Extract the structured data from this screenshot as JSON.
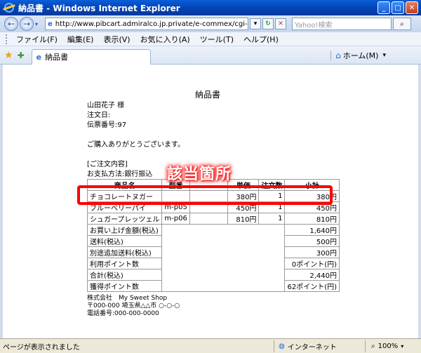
{
  "window": {
    "title": "納品書 - Windows Internet Explorer",
    "minimize": "_",
    "maximize": "□",
    "close": "✕"
  },
  "address": {
    "back": "←",
    "forward": "→",
    "dropdown": "▾",
    "url": "http://www.pibcart.admiralco.jp.private/e-commex/cgi-bin/admin/ex_sa",
    "refresh": "↻",
    "stop": "✕",
    "search_placeholder": "Yahoo!検索",
    "search_go": "⌕"
  },
  "menu": [
    "ファイル(F)",
    "編集(E)",
    "表示(V)",
    "お気に入り(A)",
    "ツール(T)",
    "ヘルプ(H)"
  ],
  "tab": {
    "label": "納品書",
    "home": "ホーム(M)",
    "home_drop": "▾"
  },
  "invoice": {
    "title": "納品書",
    "recipient": "山田花子 様",
    "order_date": "注文日:",
    "slip_no": "伝票番号:97",
    "thanks": "ご購入ありがとうございます。",
    "order_section": "[ご注文内容]",
    "payment": "お支払方法:銀行振込",
    "headers": [
      "商品名",
      "型番",
      "",
      "単価",
      "注文数",
      "小計"
    ],
    "rows": [
      [
        "チョコレートヌガー",
        "",
        "",
        "380円",
        "1",
        "380円"
      ],
      [
        "ブルーベリーパイ",
        "m-p05",
        "",
        "450円",
        "1",
        "450円"
      ],
      [
        "シュガープレッツェル",
        "m-p06",
        "",
        "810円",
        "1",
        "810円"
      ]
    ],
    "summary": [
      [
        "お買い上げ金額(税込)",
        "1,640円"
      ],
      [
        "送料(税込)",
        "500円"
      ],
      [
        "別途追加送料(税込)",
        "300円"
      ],
      [
        "利用ポイント数",
        "0ポイント(円)"
      ],
      [
        "合計(税込)",
        "2,440円"
      ],
      [
        "獲得ポイント数",
        "62ポイント(円)"
      ]
    ],
    "shop": "株式会社　My Sweet Shop",
    "address": "〒000-000 埼玉県△△市 ○-○-○",
    "phone": "電話番号:000-000-0000"
  },
  "annotation": {
    "label": "該当箇所",
    "color": "#ff0000"
  },
  "status": {
    "text": "ページが表示されました",
    "zone": "インターネット",
    "zoom": "100%"
  }
}
